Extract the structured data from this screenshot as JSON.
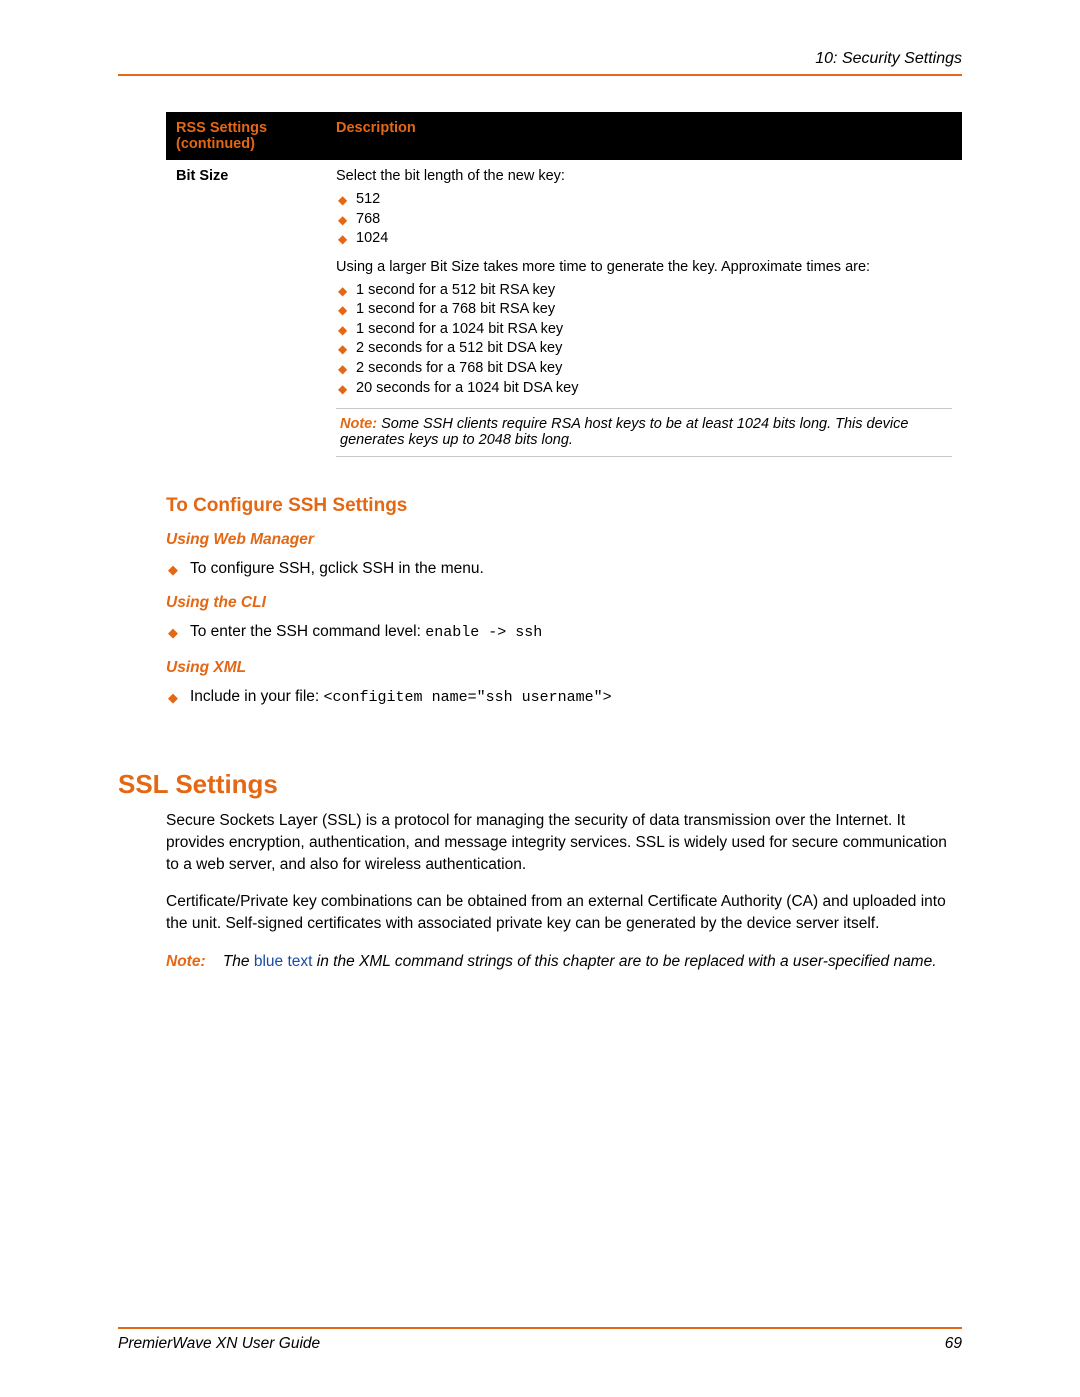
{
  "header": {
    "chapter": "10: Security Settings"
  },
  "table": {
    "col1_header_l1": "RSS Settings",
    "col1_header_l2": "(continued)",
    "col2_header": "Description",
    "row_label": "Bit Size",
    "desc_intro": "Select the bit length of the new key:",
    "sizes": [
      "512",
      "768",
      "1024"
    ],
    "desc_mid": "Using a larger Bit Size takes more time to generate the key. Approximate times are:",
    "times": [
      "1 second for a 512 bit RSA key",
      "1 second for a 768 bit RSA key",
      "1 second for a 1024 bit RSA key",
      "2 seconds for a 512 bit DSA key",
      "2 seconds for a 768 bit DSA key",
      "20 seconds for a 1024 bit DSA key"
    ],
    "note_label": "Note:",
    "note_text": "Some SSH clients require RSA host keys to be at least 1024 bits long. This device generates keys up to 2048 bits long."
  },
  "ssh": {
    "heading": "To Configure SSH Settings",
    "web_h": "Using Web Manager",
    "web_item": "To configure SSH, gclick SSH in the menu.",
    "cli_h": "Using the CLI",
    "cli_text": "To enter the SSH command level: ",
    "cli_code": "enable -> ssh",
    "xml_h": "Using XML",
    "xml_text": "Include in your file: ",
    "xml_code": "<configitem name=\"ssh username\">"
  },
  "ssl": {
    "heading": "SSL Settings",
    "p1": "Secure Sockets Layer (SSL) is a protocol for managing the security of data transmission over the Internet. It provides encryption, authentication, and message integrity services. SSL is widely used for secure communication to a web server, and also for wireless authentication.",
    "p2": "Certificate/Private key combinations can be obtained from an external Certificate Authority (CA) and uploaded into the unit. Self-signed certificates with associated private key can be generated by the device server itself.",
    "note_label": "Note:",
    "note_pre": "The ",
    "note_blue": "blue text",
    "note_post": " in the XML command strings of this chapter are to be replaced with a user-specified name."
  },
  "footer": {
    "doc_title": "PremierWave XN User Guide",
    "page_no": "69"
  }
}
